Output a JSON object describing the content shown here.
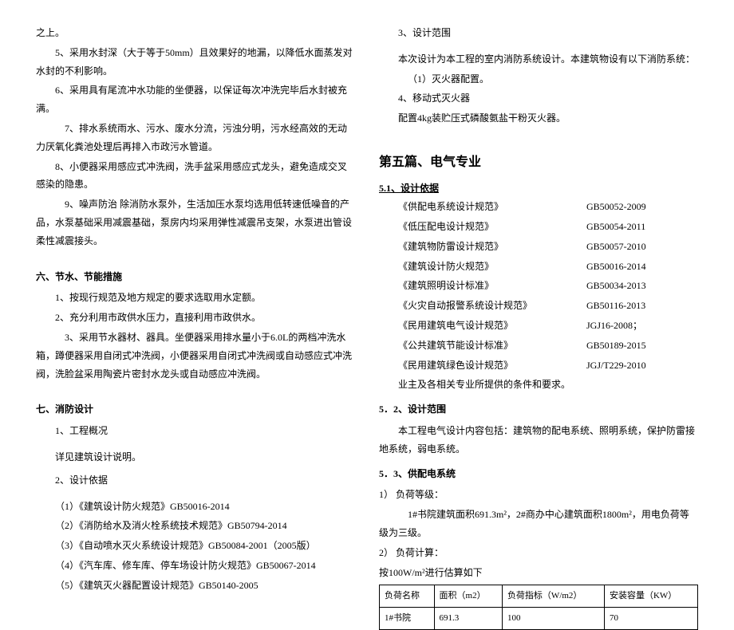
{
  "left": {
    "p0": "之上。",
    "p1": "5、采用水封深（大于等于50mm）且效果好的地漏，以降低水面蒸发对水封的不利影响。",
    "p2": "6、采用具有尾流冲水功能的坐便器，以保证每次冲洗完毕后水封被充满。",
    "p3": "7、排水系统雨水、污水、废水分流，污浊分明，污水经高效的无动力厌氧化粪池处理后再排入市政污水管道。",
    "p4": "8、小便器采用感应式冲洗阀，洗手盆采用感应式龙头，避免造成交叉感染的隐患。",
    "p5": "9、噪声防治 除消防水泵外，生活加压水泵均选用低转速低噪音的产品，水泵基础采用减震基础，泵房内均采用弹性减震吊支架，水泵进出管设柔性减震接头。",
    "sec6_title": "六、节水、节能措施",
    "sec6_p1": "1、按现行规范及地方规定的要求选取用水定额。",
    "sec6_p2": "2、充分利用市政供水压力，直接利用市政供水。",
    "sec6_p3": "3、采用节水器材、器具。坐便器采用排水量小于6.0L的两档冲洗水箱，蹲便器采用自闭式冲洗阀，小便器采用自闭式冲洗阀或自动感应式冲洗阀，洗脸盆采用陶瓷片密封水龙头或自动感应冲洗阀。",
    "sec7_title": "七、消防设计",
    "sec7_p1": "1、工程概况",
    "sec7_p2": "详见建筑设计说明。",
    "sec7_p3": "2、设计依据",
    "spec1": "（1）《建筑设计防火规范》GB50016-2014",
    "spec2": "（2）《消防给水及消火栓系统技术规范》GB50794-2014",
    "spec3": "（3）《自动喷水灭火系统设计规范》GB50084-2001（2005版）",
    "spec4": "（4）《汽车库、修车库、停车场设计防火规范》GB50067-2014",
    "spec5": "（5）《建筑灭火器配置设计规范》GB50140-2005"
  },
  "right": {
    "p1": "3、设计范围",
    "p2": "本次设计为本工程的室内消防系统设计。本建筑物设有以下消防系统：",
    "p3": "（1）灭火器配置。",
    "p4": "4、移动式灭火器",
    "p5": "配置4kg装贮压式磷酸氨盐干粉灭火器。",
    "big_title": "第五篇、电气专业",
    "s51_title": "5.1、设计依据",
    "specs": [
      {
        "name": "《供配电系统设计规范》",
        "code": "GB50052-2009"
      },
      {
        "name": "《低压配电设计规范》",
        "code": "GB50054-2011"
      },
      {
        "name": "《建筑物防雷设计规范》",
        "code": "GB50057-2010"
      },
      {
        "name": "《建筑设计防火规范》",
        "code": "GB50016-2014"
      },
      {
        "name": "《建筑照明设计标准》",
        "code": "GB50034-2013"
      },
      {
        "name": "《火灾自动报警系统设计规范》",
        "code": "GB50116-2013"
      },
      {
        "name": "《民用建筑电气设计规范》",
        "code": "JGJ16-2008；"
      },
      {
        "name": "《公共建筑节能设计标准》",
        "code": "GB50189-2015"
      },
      {
        "name": "《民用建筑绿色设计规范》",
        "code": "JGJ/T229-2010"
      }
    ],
    "s51_p_last": "业主及各相关专业所提供的条件和要求。",
    "s52_title": "5．2、设计范围",
    "s52_p1": "本工程电气设计内容包括：建筑物的配电系统、照明系统，保护防雷接地系统，弱电系统。",
    "s53_title": "5．3、供配电系统",
    "s53_p1": "1） 负荷等级：",
    "s53_p2": "1#书院建筑面积691.3m²，2#商办中心建筑面积1800m²，用电负荷等级为三级。",
    "s53_p3": "2） 负荷计算：",
    "s53_p4": "按100W/m²进行估算如下",
    "table": {
      "headers": [
        "负荷名称",
        "面积（m2）",
        "负荷指标（W/m2）",
        "安装容量（KW）"
      ],
      "row": [
        "1#书院",
        "691.3",
        "100",
        "70"
      ]
    }
  }
}
